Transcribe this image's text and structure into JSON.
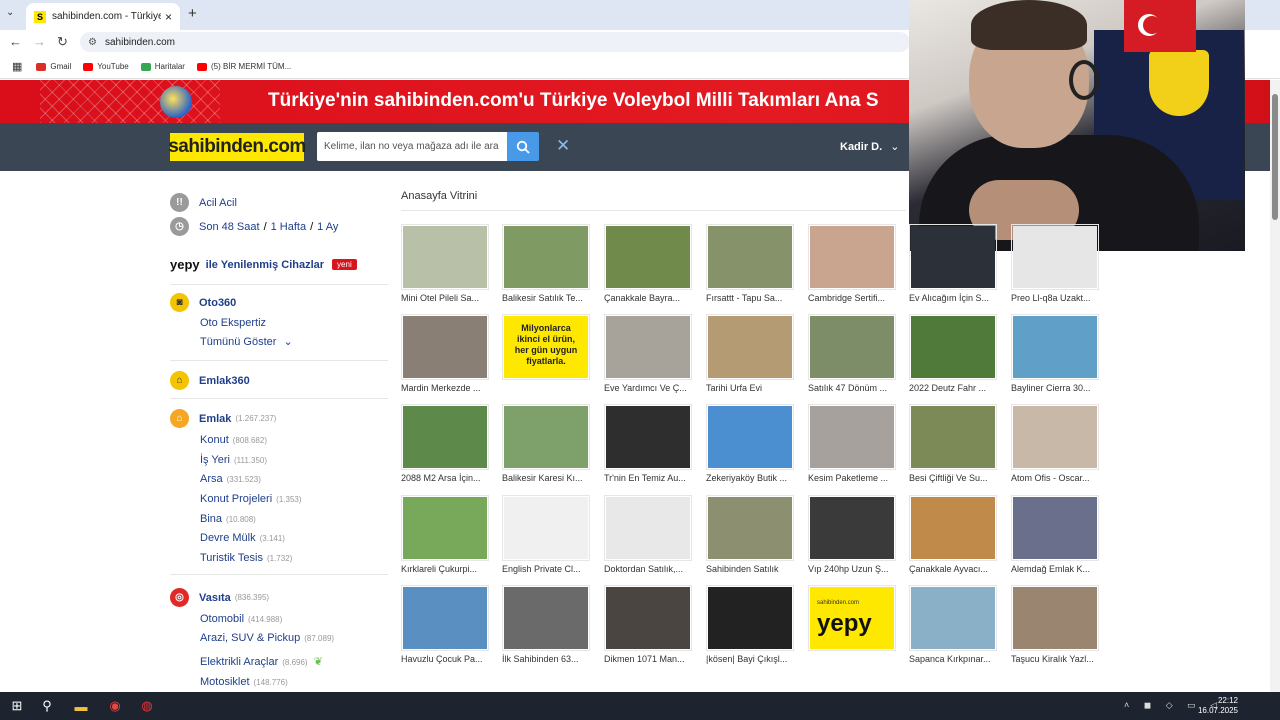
{
  "browser": {
    "tab_title": "sahibinden.com - Türkiye'nin O...",
    "url": "sahibinden.com",
    "bookmarks": [
      {
        "label": "Gmail",
        "color": "#d93025"
      },
      {
        "label": "YouTube",
        "color": "#ff0000"
      },
      {
        "label": "Haritalar",
        "color": "#34a853"
      },
      {
        "label": "(5) BİR MERMİ TÜM...",
        "color": "#ff0000"
      }
    ]
  },
  "banner": {
    "text": "Türkiye'nin sahibinden.com'u Türkiye Voleybol Milli Takımları Ana S"
  },
  "header": {
    "logo": "sahibinden.com",
    "search_placeholder": "Kelime, ilan no veya mağaza adı ile ara",
    "user": "Kadir D."
  },
  "sidebar": {
    "acil": "Acil Acil",
    "son48": "Son 48 Saat",
    "hafta": "1 Hafta",
    "ay": "1 Ay",
    "yepy_brand": "yepy",
    "yepy_text": "ile Yenilenmiş Cihazlar",
    "yeni": "yeni",
    "oto360": "Oto360",
    "oto_ekspertiz": "Oto Ekspertiz",
    "tumunu_goster": "Tümünü Göster",
    "emlak360": "Emlak360",
    "emlak": {
      "label": "Emlak",
      "count": "(1.267.237)"
    },
    "emlak_items": [
      {
        "label": "Konut",
        "count": "(808.682)"
      },
      {
        "label": "İş Yeri",
        "count": "(111.350)"
      },
      {
        "label": "Arsa",
        "count": "(331.523)"
      },
      {
        "label": "Konut Projeleri",
        "count": "(1.353)"
      },
      {
        "label": "Bina",
        "count": "(10.808)"
      },
      {
        "label": "Devre Mülk",
        "count": "(3.141)"
      },
      {
        "label": "Turistik Tesis",
        "count": "(1.732)"
      }
    ],
    "vasita": {
      "label": "Vasıta",
      "count": "(836.395)"
    },
    "vasita_items": [
      {
        "label": "Otomobil",
        "count": "(414.988)"
      },
      {
        "label": "Arazi, SUV & Pickup",
        "count": "(87.089)"
      },
      {
        "label": "Elektrikli Araçlar",
        "count": "(8.696)"
      },
      {
        "label": "Motosiklet",
        "count": "(148.776)"
      }
    ]
  },
  "showcase": {
    "title": "Anasayfa Vitrini",
    "rows": [
      [
        {
          "caption": "Mini Otel Pileli Sa...",
          "color": "#b9c0a8"
        },
        {
          "caption": "Balikesir Satılık Te...",
          "color": "#7f9a63"
        },
        {
          "caption": "Çanakkale Bayra...",
          "color": "#6f8a4a"
        },
        {
          "caption": "Fırsattt - Tapu Sa...",
          "color": "#86926a"
        },
        {
          "caption": "Cambridge Sertifi...",
          "color": "#c9a590"
        },
        {
          "caption": "Ev Alıcağım İçin S...",
          "color": "#2c3038"
        },
        {
          "caption": "Preo Ll-q8a Uzakt...",
          "color": "#e6e6e6"
        }
      ],
      [
        {
          "caption": "Mardin Merkezde ...",
          "color": "#8a7f74"
        },
        {
          "caption": "",
          "color": "#ffe800"
        },
        {
          "caption": "Eve Yardımcı Ve Ç...",
          "color": "#a8a39a"
        },
        {
          "caption": "Tarihi Urfa Evi",
          "color": "#b49b73"
        },
        {
          "caption": "Satılık 47 Dönüm ...",
          "color": "#7d8d68"
        },
        {
          "caption": "2022 Deutz Fahr ...",
          "color": "#4f7a3a"
        },
        {
          "caption": "Bayliner Cierra 30...",
          "color": "#5f9fc8"
        }
      ],
      [
        {
          "caption": "2088 M2 Arsa İçin...",
          "color": "#5d8a4a"
        },
        {
          "caption": "Balikesir Karesi Kı...",
          "color": "#7ea06a"
        },
        {
          "caption": "Tr'nin En Temiz Au...",
          "color": "#2e2e2e"
        },
        {
          "caption": "Zekeriyaköy Butik ...",
          "color": "#4b8fd0"
        },
        {
          "caption": "Kesim Paketleme ...",
          "color": "#a6a19c"
        },
        {
          "caption": "Besi Çiftliği Ve Su...",
          "color": "#7c8a58"
        },
        {
          "caption": "Atom Ofis - Oscar...",
          "color": "#c8b8a8"
        }
      ],
      [
        {
          "caption": "Kırklareli Çukurpi...",
          "color": "#78a85a"
        },
        {
          "caption": "English Private Cl...",
          "color": "#f0f0f0"
        },
        {
          "caption": "Doktordan Satılık,...",
          "color": "#e8e8e8"
        },
        {
          "caption": "Sahibinden Satılık",
          "color": "#8d9070"
        },
        {
          "caption": "Vıp 240hp Uzun Ş...",
          "color": "#3a3a3a"
        },
        {
          "caption": "Çanakkale Ayvacı...",
          "color": "#c08a4a"
        },
        {
          "caption": "Alemdağ Emlak K...",
          "color": "#6a6f8c"
        }
      ],
      [
        {
          "caption": "Havuzlu Çocuk Pa...",
          "color": "#5a8fc2"
        },
        {
          "caption": "İlk Sahibinden 63...",
          "color": "#6a6a6a"
        },
        {
          "caption": "Dikmen 1071 Man...",
          "color": "#4a4540"
        },
        {
          "caption": "|kösen| Bayi Çıkışl...",
          "color": "#222222"
        },
        {
          "caption": "",
          "color": "#ffe800"
        },
        {
          "caption": "Sapanca Kırkpınar...",
          "color": "#8ab0c8"
        },
        {
          "caption": "Taşucu Kiralık Yazl...",
          "color": "#9a8570"
        }
      ]
    ],
    "promo_text": "Milyonlarca ikinci el ürün, her gün uygun fiyatlarla.",
    "yepy_logo": "yepy",
    "sahibinden_small": "sahibinden.com"
  },
  "taskbar": {
    "time": "22:12",
    "date": "16.07.2025"
  }
}
